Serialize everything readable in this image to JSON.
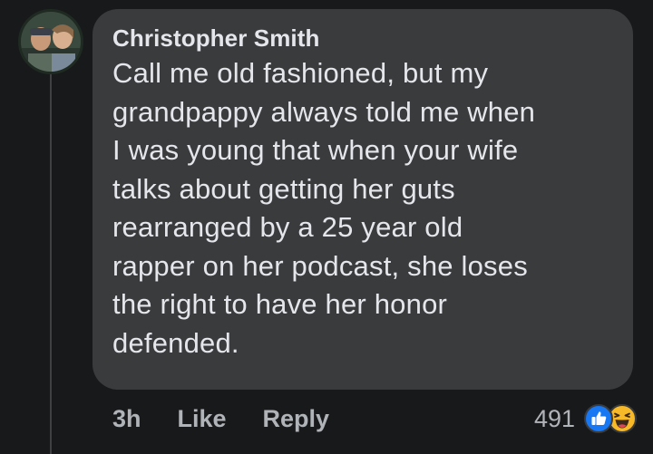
{
  "comment": {
    "author": "Christopher Smith",
    "lines": [
      "Call me old fashioned, but my",
      "grandpappy always told me when",
      "I was young that when your wife",
      "talks about getting her guts",
      "rearranged by a 25 year old",
      "rapper on her podcast, she loses",
      "the right to have her honor",
      "defended."
    ],
    "timestamp": "3h",
    "like_label": "Like",
    "reply_label": "Reply",
    "reaction_count": "491",
    "reaction_icons": [
      "like-reaction-icon",
      "haha-reaction-icon"
    ]
  },
  "colors": {
    "background": "#18191a",
    "bubble": "#3a3b3c",
    "text_primary": "#e4e6eb",
    "text_secondary": "#b0b3b8",
    "like_blue": "#1877f2",
    "haha_yellow": "#f7b928"
  }
}
